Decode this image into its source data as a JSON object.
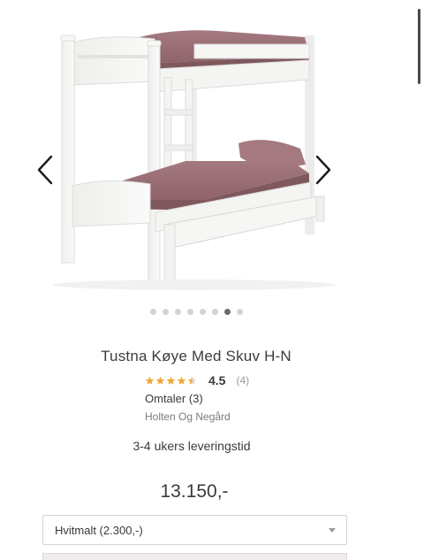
{
  "product": {
    "title": "Tustna Køye Med Skuv H-N",
    "rating_value": "4.5",
    "rating_count": "(4)",
    "rating_fraction": 0.9,
    "reviews_link": "Omtaler (3)",
    "brand": "Holten Og Negård",
    "delivery": "3-4 ukers leveringstid",
    "price": "13.150,-",
    "variant_selected": "Hvitmalt (2.300,-)"
  },
  "gallery": {
    "slide_count": 8,
    "active_slide": 7,
    "image_icon": "bunk-bed-image",
    "prev_icon": "chevron-left-icon",
    "next_icon": "chevron-right-icon"
  },
  "colors": {
    "star": "#f2a93b",
    "mattress": "#9b6f74",
    "frame": "#f7f7f5",
    "dot_active": "#6b6b6b",
    "dot_inactive": "#d3d3d3"
  }
}
